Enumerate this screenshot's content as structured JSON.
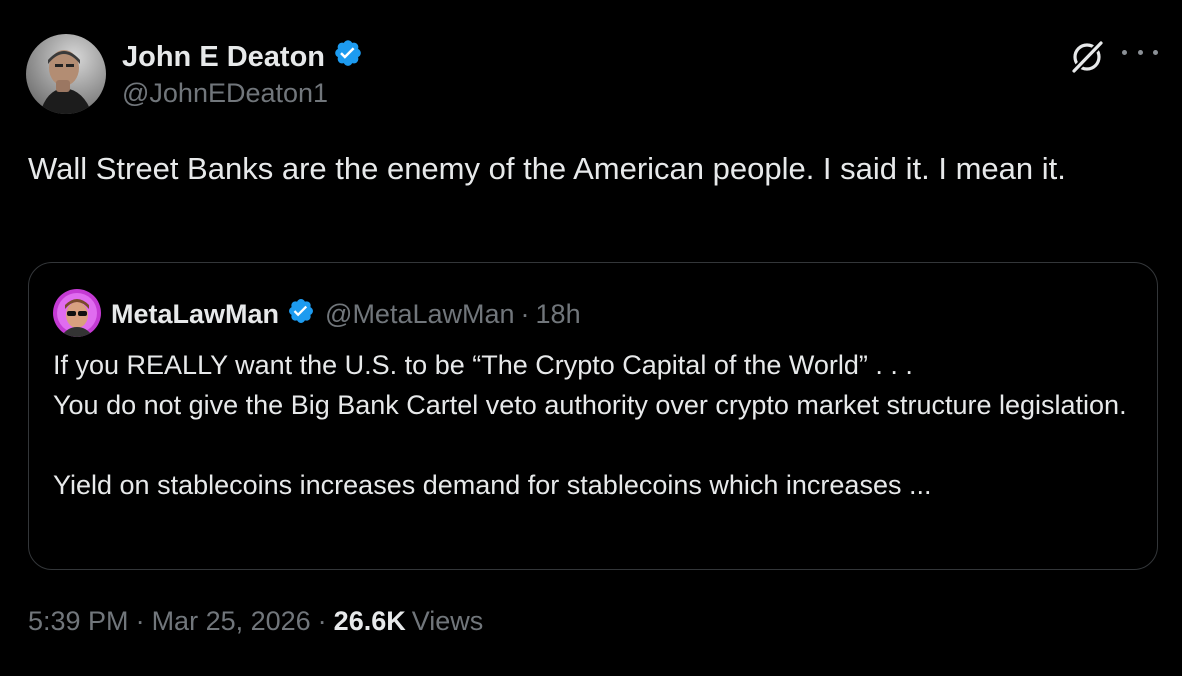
{
  "author": {
    "name": "John E Deaton",
    "handle": "@JohnEDeaton1",
    "verified": true
  },
  "tweet": {
    "text": "Wall Street Banks are the enemy of the American people. I said it. I mean it."
  },
  "quote": {
    "name": "MetaLawMan",
    "handle": "@MetaLawMan",
    "dot": "·",
    "time": "18h",
    "verified": true,
    "lines": [
      "If you REALLY want the U.S. to be “The Crypto Capital of the World” . . .",
      "You do not give the Big Bank Cartel veto authority over crypto market structure legislation."
    ],
    "lines2": [
      "Yield on stablecoins increases demand for stablecoins which increases ..."
    ]
  },
  "meta": {
    "time": "5:39 PM",
    "sep1": "·",
    "date": "Mar 25, 2026",
    "sep2": "·",
    "views_count": "26.6K",
    "views_label": "Views"
  },
  "colors": {
    "background": "#000000",
    "text": "#e7e9ea",
    "muted": "#71767b",
    "verified": "#1d9bf0",
    "border": "#333639"
  },
  "icons": [
    "verified-badge-icon",
    "grok-icon",
    "more-icon"
  ]
}
